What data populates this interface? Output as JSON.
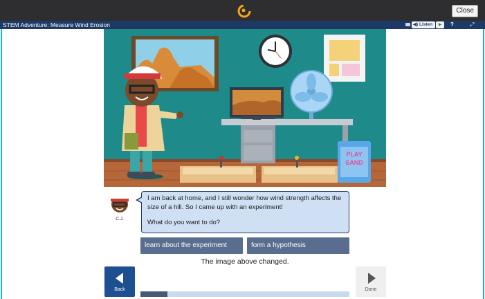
{
  "header": {
    "close_label": "Close",
    "title": "STEM Adventure: Measure Wind Erosion",
    "listen_label": "Listen",
    "icons": [
      "logo-icon",
      "captions-icon",
      "speaker-icon",
      "play-icon",
      "help-icon",
      "fullscreen-icon"
    ]
  },
  "dialogue": {
    "speaker": "C.J.",
    "line1": "I am back at home, and I still wonder how wind strength affects the size of a hill. So I came up with an experiment!",
    "line2": "What do you want to do?"
  },
  "choices": [
    {
      "label": "learn about the experiment"
    },
    {
      "label": "form a hypothesis"
    }
  ],
  "status_message": "The image above changed.",
  "nav": {
    "back_label": "Back",
    "done_label": "Done"
  },
  "progress": {
    "fraction": 0.13
  },
  "scene": {
    "bag_text_1": "PLAY",
    "bag_text_2": "SAND"
  },
  "colors": {
    "title_bar": "#1d3a66",
    "frame": "#19b6c9",
    "choice_bg": "#596d8e",
    "back_bg": "#1d4f91",
    "wall": "#1f8a8a"
  }
}
